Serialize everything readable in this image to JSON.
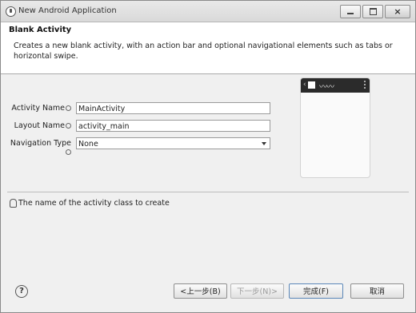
{
  "window": {
    "title": "New Android Application"
  },
  "header": {
    "title": "Blank Activity",
    "description": "Creates a new blank activity, with an action bar and optional navigational elements such as tabs or horizontal swipe."
  },
  "form": {
    "activity_name": {
      "label": "Activity Name",
      "value": "MainActivity"
    },
    "layout_name": {
      "label": "Layout Name",
      "value": "activity_main"
    },
    "navigation_type": {
      "label": "Navigation Type",
      "value": "None"
    }
  },
  "hint": {
    "text": "The name of the activity class to create"
  },
  "buttons": {
    "help": "?",
    "back": "<上一步(B)",
    "next": "下一步(N)>",
    "finish": "完成(F)",
    "cancel": "取消"
  },
  "preview": {
    "back_glyph": "‹",
    "title_squiggle": "〰〰"
  },
  "icons": {
    "app": "android-app-icon",
    "hint": "lightbulb-icon",
    "help": "help-circle-icon"
  }
}
